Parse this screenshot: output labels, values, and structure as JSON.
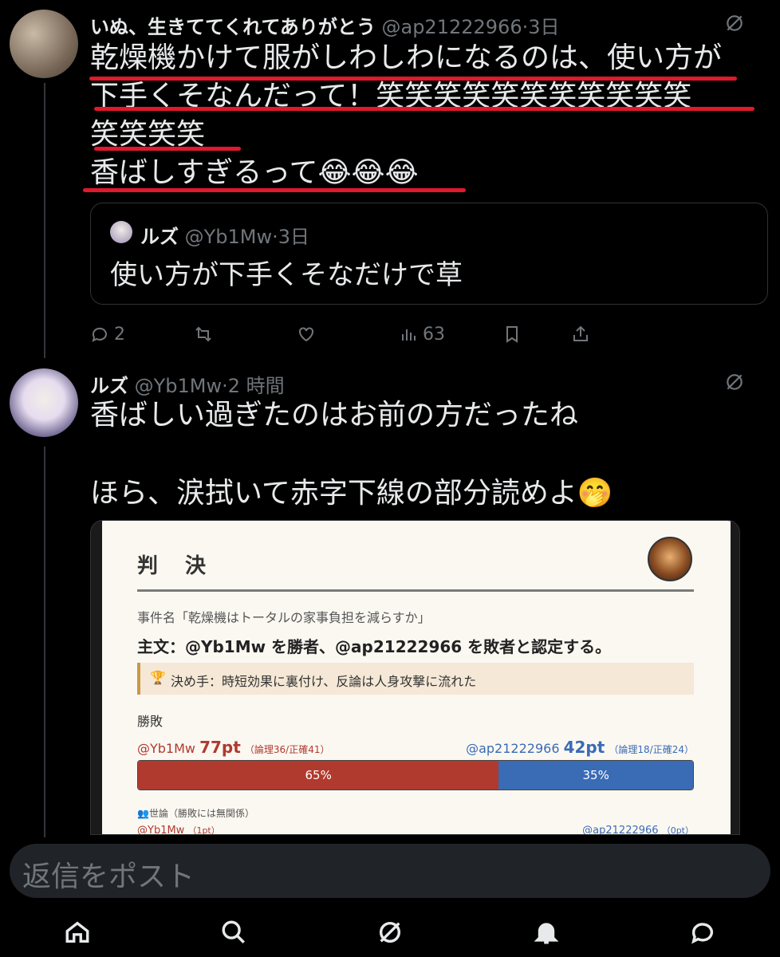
{
  "tweet1": {
    "display_name": "いぬ、生きててくれてありがとう",
    "handle": "@ap21222966",
    "time": "·3日",
    "lines": [
      "乾燥機かけて服がしわしわになるのは、使い方が",
      "下手くそなんだって！笑笑笑笑笑笑笑笑笑笑笑",
      "笑笑笑笑",
      "香ばしすぎるって😂😂😂"
    ],
    "quote": {
      "display_name": "ルズ",
      "handle": "@Yb1Mw",
      "time": "·3日",
      "text": "使い方が下手くそなだけで草"
    },
    "actions": {
      "replies": "2",
      "views": "63"
    }
  },
  "tweet2": {
    "display_name": "ルズ",
    "handle": "@Yb1Mw",
    "time": "·2 時間",
    "line1": "香ばしい過ぎたのはお前の方だったね",
    "line2": "ほら、涙拭いて赤字下線の部分読めよ🤭"
  },
  "judgment": {
    "title": "判　決",
    "case_name": "事件名「乾燥機はトータルの家事負担を減らすか」",
    "main_text": "主文：@Yb1Mw を勝者、@ap21222966 を敗者と認定する。",
    "decisive": "決め手：時短効果に裏付け、反論は人身攻撃に流れた",
    "result_label": "勝敗",
    "winner": {
      "handle": "@Yb1Mw",
      "points": "77pt",
      "detail": "（論理36/正確41）",
      "percent_label": "65%",
      "share": 0.65
    },
    "loser": {
      "handle": "@ap21222966",
      "points": "42pt",
      "detail": "（論理18/正確24）",
      "percent_label": "35%",
      "share": 0.35
    },
    "opinion_label": "世論（勝敗には無関係）",
    "opinion_left": {
      "handle": "@Yb1Mw",
      "pts": "（1pt）"
    },
    "opinion_right": {
      "handle": "@ap21222966",
      "pts": "（0pt）"
    },
    "colors": {
      "winner": "#b03a2e",
      "loser": "#3a6bb5"
    }
  },
  "reply_bar": {
    "placeholder": "返信をポスト"
  },
  "nav": [
    "home-icon",
    "search-icon",
    "grok-icon",
    "notifications-icon",
    "messages-icon"
  ]
}
